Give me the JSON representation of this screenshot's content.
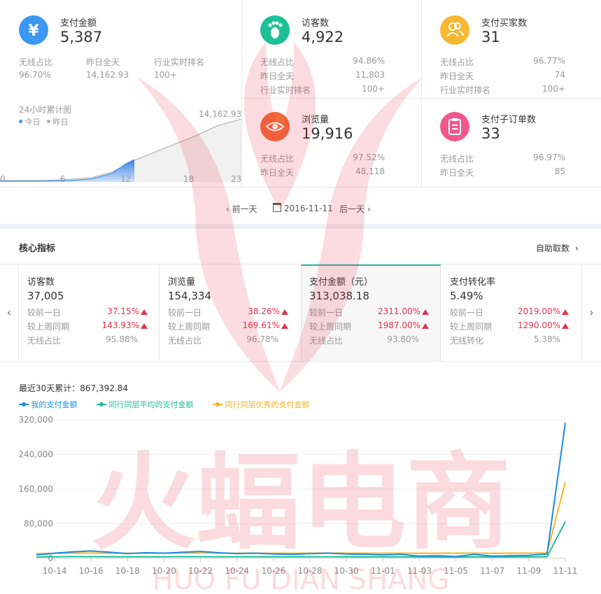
{
  "top": {
    "pay_amount": {
      "label": "支付金额",
      "value": "5,387",
      "icon": "yen-icon",
      "color": "#3a97f2",
      "wireless_label": "无线占比",
      "wireless_value": "96.70%",
      "yesterday_label": "昨日全天",
      "yesterday_value": "14,162.93",
      "rank_label": "行业实时排名",
      "rank_value": "100+"
    },
    "chart24": {
      "title": "24小时累计图",
      "legend_today": "今日",
      "legend_yesterday": "昨日",
      "peak_label": "14,162.93",
      "x_ticks": [
        "0",
        "6",
        "12",
        "18",
        "23"
      ],
      "today_color": "#3a97f2",
      "yesterday_color": "#aaaaaa"
    },
    "visitors": {
      "label": "访客数",
      "value": "4,922",
      "icon": "footprint-icon",
      "color": "#1dbf97",
      "wireless_label": "无线占比",
      "wireless_value": "94.86%",
      "yesterday_label": "昨日全天",
      "yesterday_value": "11,803",
      "rank_label": "行业实时排名",
      "rank_value": "100+"
    },
    "buyers": {
      "label": "支付买家数",
      "value": "31",
      "icon": "users-icon",
      "color": "#f6b731",
      "wireless_label": "无线占比",
      "wireless_value": "96.77%",
      "yesterday_label": "昨日全天",
      "yesterday_value": "74",
      "rank_label": "行业实时排名",
      "rank_value": "100+"
    },
    "pageviews": {
      "label": "浏览量",
      "value": "19,916",
      "icon": "eye-icon",
      "color": "#f26b3a",
      "wireless_label": "无线占比",
      "wireless_value": "97.52%",
      "yesterday_label": "昨日全天",
      "yesterday_value": "48,118"
    },
    "orders": {
      "label": "支付子订单数",
      "value": "33",
      "icon": "clipboard-icon",
      "color": "#f0588c",
      "wireless_label": "无线占比",
      "wireless_value": "96.97%",
      "yesterday_label": "昨日全天",
      "yesterday_value": "85"
    }
  },
  "datenav": {
    "prev": "前一天",
    "date": "2016-11-11",
    "next": "后一天"
  },
  "core": {
    "title": "核心指标",
    "self_fetch": "自助取数",
    "cards": [
      {
        "label": "访客数",
        "value": "37,005",
        "r1_label": "较前一日",
        "r1_value": "37.15%",
        "r2_label": "较上周同期",
        "r2_value": "143.93%",
        "r3_label": "无线占比",
        "r3_value": "95.88%"
      },
      {
        "label": "浏览量",
        "value": "154,334",
        "r1_label": "较前一日",
        "r1_value": "38.26%",
        "r2_label": "较上周同期",
        "r2_value": "169.61%",
        "r3_label": "无线占比",
        "r3_value": "96.78%"
      },
      {
        "label": "支付金额（元）",
        "value": "313,038.18",
        "r1_label": "较前一日",
        "r1_value": "2311.00%",
        "r2_label": "较上周同期",
        "r2_value": "1987.00%",
        "r3_label": "无线占比",
        "r3_value": "93.80%"
      },
      {
        "label": "支付转化率",
        "value": "5.49%",
        "r1_label": "较前一日",
        "r1_value": "2019.00%",
        "r2_label": "较上周同期",
        "r2_value": "1290.00%",
        "r3_label": "无线转化",
        "r3_value": "5.38%"
      }
    ]
  },
  "trend": {
    "label": "最近30天累计：867,392.84"
  },
  "watermark": {
    "main": "火蝠电商",
    "sub": "HUO FU DIAN SHANG"
  },
  "chart_data": {
    "type": "line",
    "x": [
      "10-13",
      "10-14",
      "10-15",
      "10-16",
      "10-17",
      "10-18",
      "10-19",
      "10-20",
      "10-21",
      "10-22",
      "10-23",
      "10-24",
      "10-25",
      "10-26",
      "10-27",
      "10-28",
      "10-29",
      "10-30",
      "10-31",
      "11-01",
      "11-02",
      "11-03",
      "11-04",
      "11-05",
      "11-06",
      "11-07",
      "11-08",
      "11-09",
      "11-10",
      "11-11"
    ],
    "tick_labels": [
      "10-14",
      "10-16",
      "10-18",
      "10-20",
      "10-22",
      "10-24",
      "10-26",
      "10-28",
      "10-30",
      "11-01",
      "11-03",
      "11-05",
      "11-07",
      "11-09",
      "11-11"
    ],
    "y_ticks": [
      "0",
      "80,000",
      "160,000",
      "240,000",
      "320,000"
    ],
    "ylim": [
      0,
      320000
    ],
    "series": [
      {
        "name": "我的支付金额",
        "color": "#1a8ce0",
        "values": [
          8000,
          12000,
          15000,
          17000,
          14000,
          11000,
          13000,
          12000,
          14000,
          16000,
          13000,
          11000,
          12000,
          10000,
          9000,
          11000,
          12000,
          10000,
          9000,
          8000,
          9000,
          5000,
          6000,
          4000,
          9000,
          5000,
          6000,
          7000,
          10000,
          313000
        ]
      },
      {
        "name": "同行同层平均的支付金额",
        "color": "#1fbf9b",
        "values": [
          3000,
          3500,
          4000,
          3800,
          3600,
          3500,
          3700,
          3600,
          3800,
          3900,
          3700,
          3600,
          3500,
          3400,
          3500,
          3600,
          3500,
          3400,
          3300,
          3200,
          3300,
          3100,
          3000,
          3100,
          3200,
          3000,
          3100,
          3200,
          3500,
          85000
        ]
      },
      {
        "name": "同行同层优秀的支付金额",
        "color": "#f5b325",
        "values": [
          11000,
          11500,
          12000,
          12200,
          11800,
          11600,
          12000,
          11900,
          12100,
          12300,
          12000,
          11800,
          11900,
          11700,
          11800,
          12000,
          12100,
          11900,
          12000,
          11800,
          11900,
          11700,
          11800,
          11900,
          12000,
          11800,
          11900,
          12000,
          12500,
          176000
        ]
      }
    ]
  }
}
